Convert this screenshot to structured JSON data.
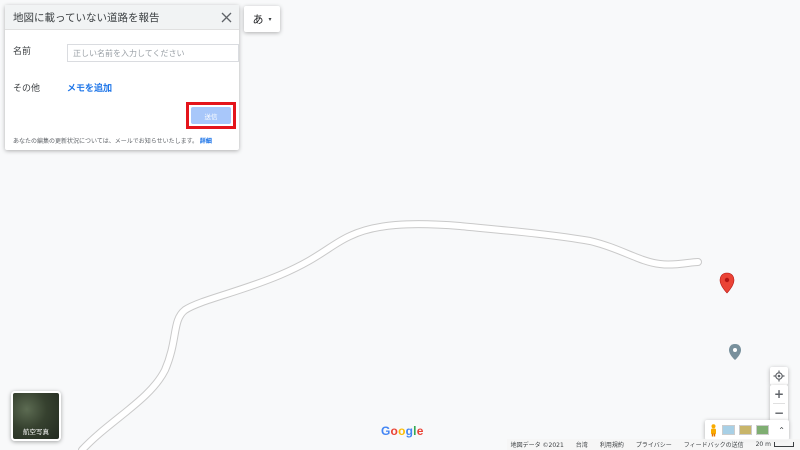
{
  "panel": {
    "title": "地図に載っていない道路を報告",
    "name_label": "名前",
    "name_placeholder": "正しい名前を入力してください",
    "name_value": "",
    "other_label": "その他",
    "memo_link": "メモを追加",
    "submit_label": "送信",
    "note_text": "あなたの編集の更新状況については、メールでお知らせいたします。",
    "note_link": "詳細",
    "close_icon": "close-icon"
  },
  "ime": {
    "label": "あ",
    "caret": "▾"
  },
  "aerial": {
    "label": "航空写真"
  },
  "logo": {
    "letters": [
      "G",
      "o",
      "o",
      "g",
      "l",
      "e"
    ],
    "colors": [
      "#4285F4",
      "#EA4335",
      "#FBBC05",
      "#4285F4",
      "#34A853",
      "#EA4335"
    ]
  },
  "footer": {
    "map_data": "地図データ ©2021",
    "region": "台湾",
    "terms": "利用規約",
    "privacy": "プライバシー",
    "feedback": "フィードバックの送信",
    "scale": "20 m"
  },
  "controls": {
    "zoom_in": "+",
    "zoom_out": "−",
    "expand": "⌃"
  },
  "colors": {
    "accent": "#1a73e8",
    "marker": "#ea4335",
    "highlight": "#e4141b",
    "road_fill": "#ffffff",
    "road_edge": "#c9c9c9"
  }
}
